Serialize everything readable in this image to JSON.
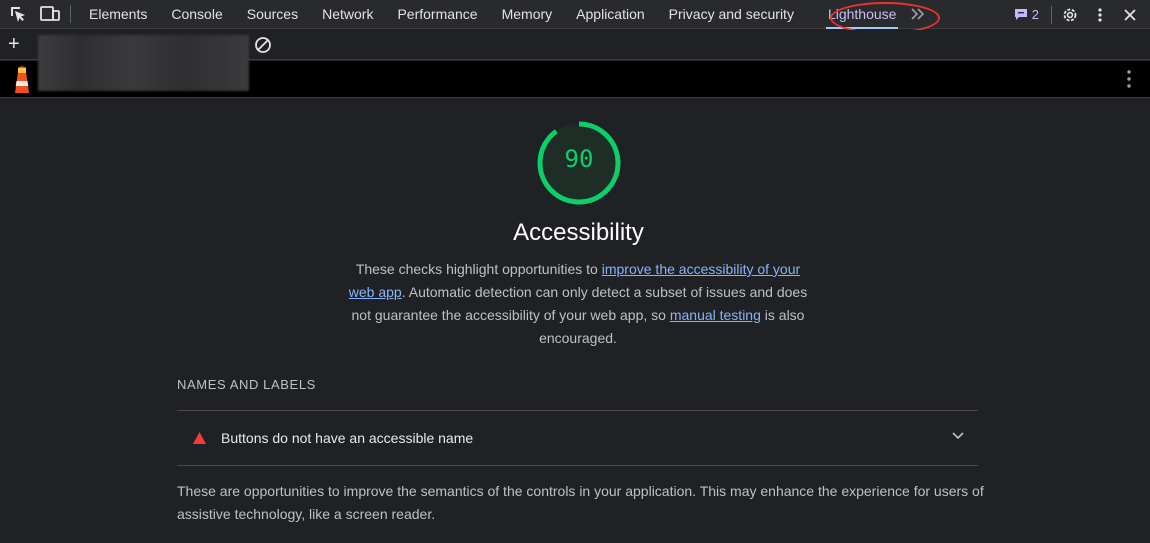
{
  "devtools": {
    "tabs": [
      {
        "label": "Elements"
      },
      {
        "label": "Console"
      },
      {
        "label": "Sources"
      },
      {
        "label": "Network"
      },
      {
        "label": "Performance"
      },
      {
        "label": "Memory"
      },
      {
        "label": "Application"
      },
      {
        "label": "Privacy and security"
      },
      {
        "label": "Lighthouse"
      }
    ],
    "active_tab": "Lighthouse",
    "issues_count": "2"
  },
  "report": {
    "score": "90",
    "score_color": "#0cce6b",
    "category_title": "Accessibility",
    "description": {
      "part1": "These checks highlight opportunities to ",
      "link1": "improve the accessibility of your web app",
      "part2": ". Automatic detection can only detect a subset of issues and does not guarantee the accessibility of your web app, so ",
      "link2": "manual testing",
      "part3": " is also encouraged."
    },
    "group": {
      "title": "NAMES AND LABELS",
      "audit_title": "Buttons do not have an accessible name",
      "description": "These are opportunities to improve the semantics of the controls in your application. This may enhance the experience for users of assistive technology, like a screen reader."
    }
  },
  "colors": {
    "accent": "#a8c7fa",
    "link": "#8ab4f8",
    "fail": "#f33b3b",
    "annotation": "#e8322f"
  }
}
